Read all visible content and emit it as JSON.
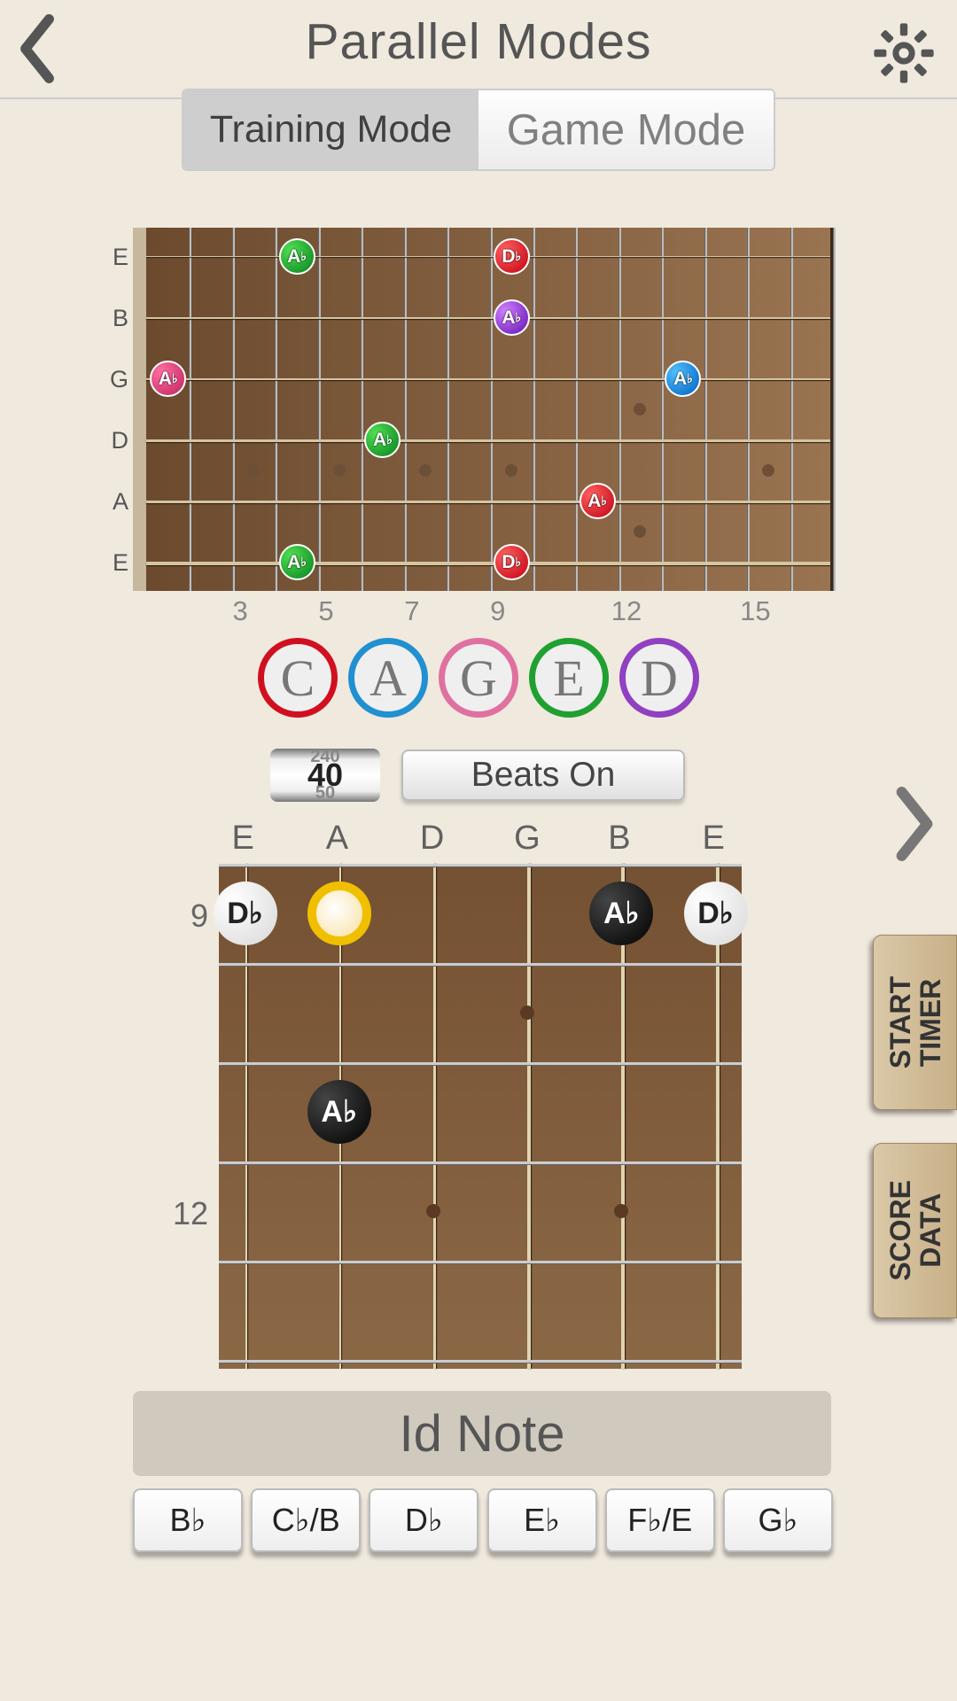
{
  "header": {
    "title": "Parallel Modes"
  },
  "modes": {
    "tab1": "Training Mode",
    "tab2": "Game Mode",
    "active": 0
  },
  "fb1": {
    "strings": [
      "E",
      "B",
      "G",
      "D",
      "A",
      "E"
    ],
    "fretNumbers": [
      3,
      5,
      7,
      9,
      12,
      15
    ],
    "markers": [
      {
        "string": 0,
        "fret": 4,
        "label": "A♭",
        "color": "green"
      },
      {
        "string": 0,
        "fret": 9,
        "label": "D♭",
        "color": "red"
      },
      {
        "string": 1,
        "fret": 9,
        "label": "A♭",
        "color": "purple"
      },
      {
        "string": 2,
        "fret": 1,
        "label": "A♭",
        "color": "pink"
      },
      {
        "string": 2,
        "fret": 13,
        "label": "A♭",
        "color": "blue"
      },
      {
        "string": 3,
        "fret": 6,
        "label": "A♭",
        "color": "green"
      },
      {
        "string": 4,
        "fret": 11,
        "label": "A♭",
        "color": "red"
      },
      {
        "string": 5,
        "fret": 4,
        "label": "A♭",
        "color": "green"
      },
      {
        "string": 5,
        "fret": 9,
        "label": "D♭",
        "color": "red"
      }
    ]
  },
  "caged": [
    "C",
    "A",
    "G",
    "E",
    "D"
  ],
  "tempo": {
    "value": "40",
    "ghostTop": "240",
    "ghostBottom": "50",
    "beatsLabel": "Beats On"
  },
  "chord": {
    "strings": [
      "E",
      "A",
      "D",
      "G",
      "B",
      "E"
    ],
    "fretLabels": [
      "9",
      "12"
    ],
    "markers": [
      {
        "string": 0,
        "fret": 0,
        "label": "D♭",
        "style": "white"
      },
      {
        "string": 1,
        "fret": 0,
        "label": "",
        "style": "yellow"
      },
      {
        "string": 4,
        "fret": 0,
        "label": "A♭",
        "style": "black"
      },
      {
        "string": 5,
        "fret": 0,
        "label": "D♭",
        "style": "white"
      },
      {
        "string": 1,
        "fret": 2,
        "label": "A♭",
        "style": "black"
      }
    ]
  },
  "buttons": {
    "idNote": "Id Note",
    "notes": [
      "B♭",
      "C♭/B",
      "D♭",
      "E♭",
      "F♭/E",
      "G♭"
    ],
    "startTimer": "START\nTIMER",
    "scoreData": "SCORE\nDATA"
  }
}
